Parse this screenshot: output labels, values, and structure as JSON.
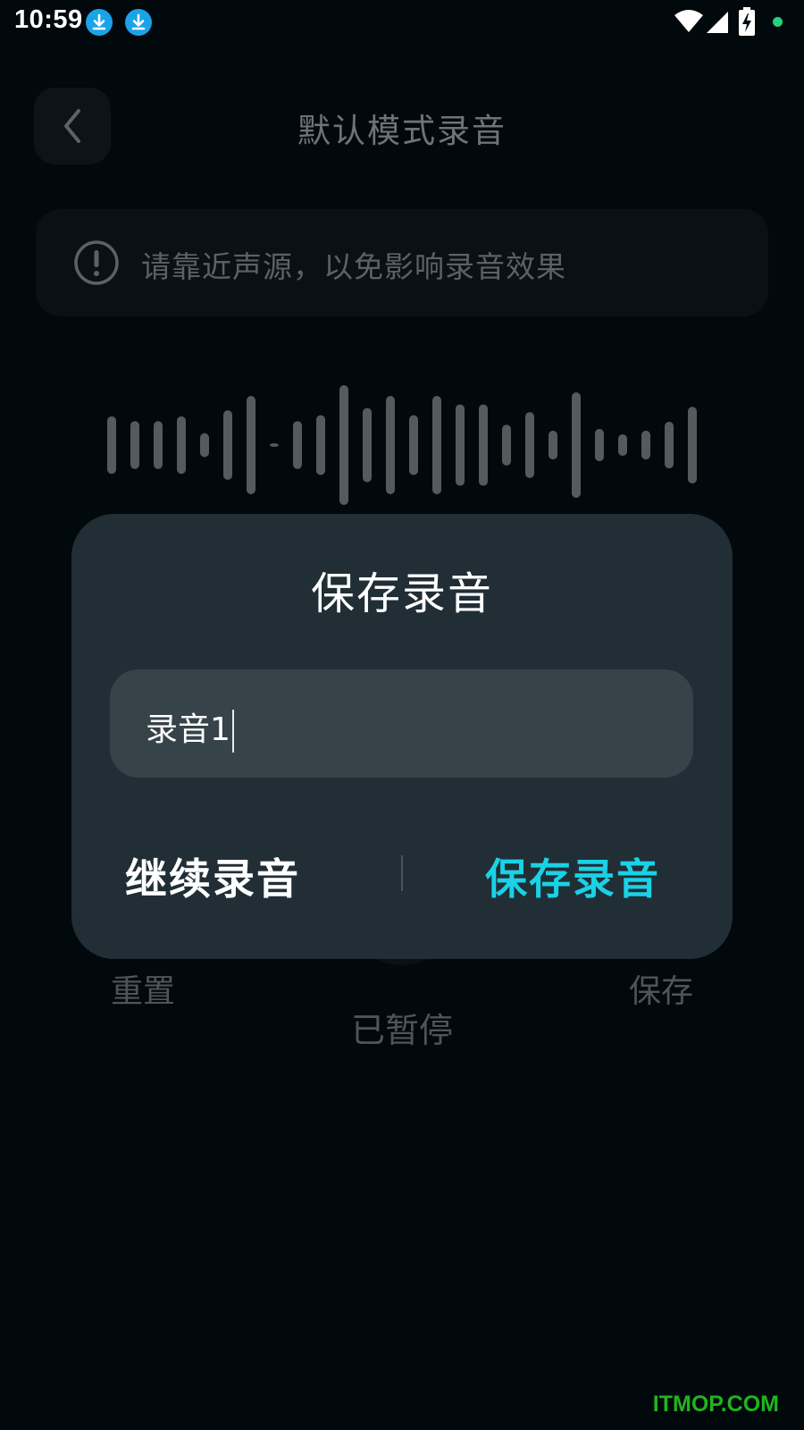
{
  "status_bar": {
    "time": "10:59",
    "notification_icons": [
      "download-icon",
      "download-icon"
    ],
    "right_icons": [
      "wifi-icon",
      "signal-icon",
      "battery-charging-icon",
      "green-dot-icon"
    ]
  },
  "header": {
    "back_icon": "chevron-left-icon",
    "title": "默认模式录音"
  },
  "tip": {
    "icon": "exclamation-circle-icon",
    "text": "请靠近声源，以免影响录音效果"
  },
  "waveform": {
    "levels": [
      0.48,
      0.4,
      0.4,
      0.48,
      0.2,
      0.58,
      0.82,
      0.03,
      0.4,
      0.5,
      1.0,
      0.62,
      0.82,
      0.5,
      0.82,
      0.68,
      0.68,
      0.34,
      0.55,
      0.24,
      0.88,
      0.27,
      0.18,
      0.24,
      0.39,
      0.64
    ]
  },
  "controls": {
    "reset_label": "重置",
    "save_label": "保存",
    "status_label": "已暂停"
  },
  "dialog": {
    "title": "保存录音",
    "input_value": "录音1",
    "continue_label": "继续录音",
    "save_label": "保存录音"
  },
  "watermark": "ITMOP.COM",
  "colors": {
    "background": "#02090d",
    "dialog": "#212e36",
    "input": "#364349",
    "accent": "#19d2e6",
    "wave_bar": "#555a5d"
  }
}
